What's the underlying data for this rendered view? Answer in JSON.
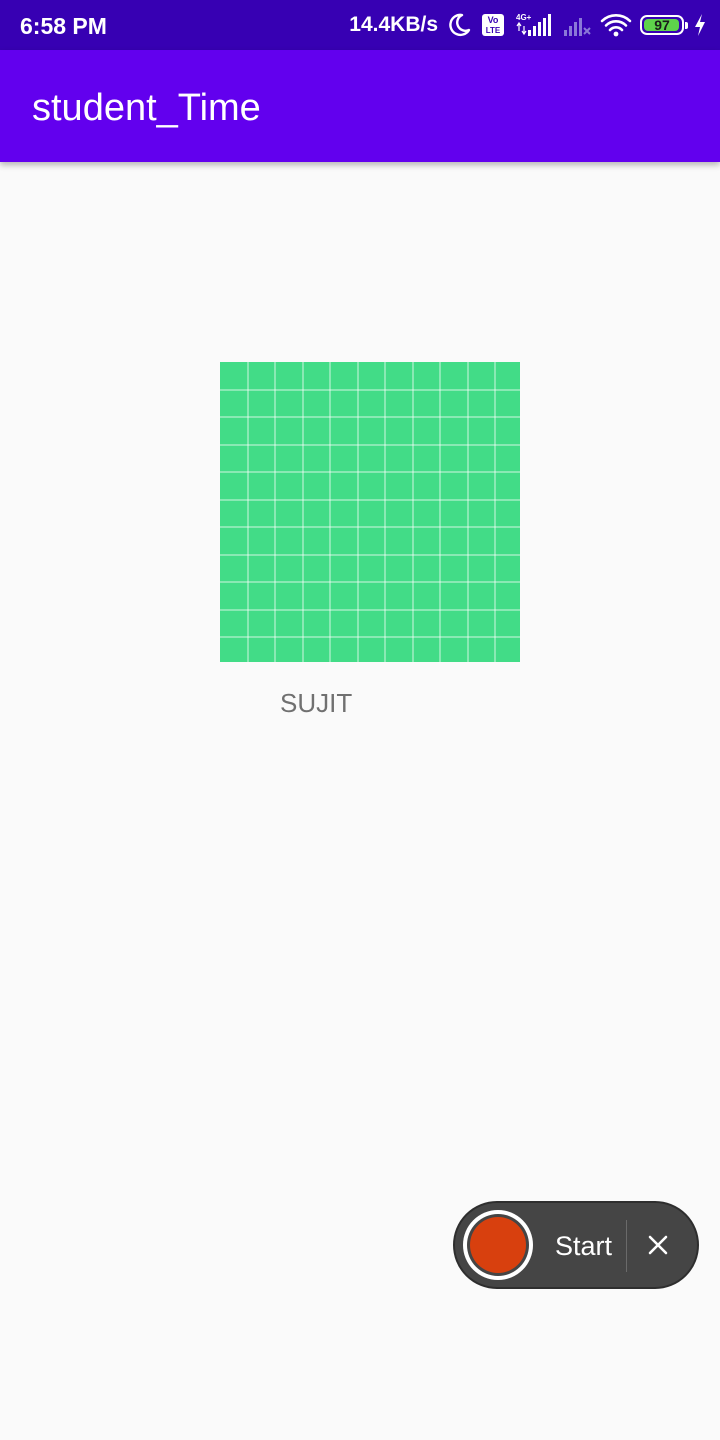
{
  "status_bar": {
    "time": "6:58 PM",
    "network_speed": "14.4KB/s",
    "volte_badge": "Vo LTE",
    "signal_badge": "4G+",
    "battery_percent": "97",
    "battery_level": 0.97,
    "icons": [
      "moon-icon",
      "volte-icon",
      "signal-icon",
      "signal-no-sim-icon",
      "wifi-icon",
      "battery-icon",
      "charging-icon"
    ]
  },
  "app_bar": {
    "title": "student_Time"
  },
  "main": {
    "image_icon": "grid-placeholder-image",
    "student_name": "SUJIT"
  },
  "recorder": {
    "start_label": "Start",
    "close_icon": "close-icon"
  },
  "colors": {
    "status_bar": "#3700b3",
    "app_bar": "#6200ee",
    "background": "#fafafa",
    "grid_green": "#42dc87",
    "record_red": "#d8400e",
    "recorder_bg": "#454545"
  }
}
